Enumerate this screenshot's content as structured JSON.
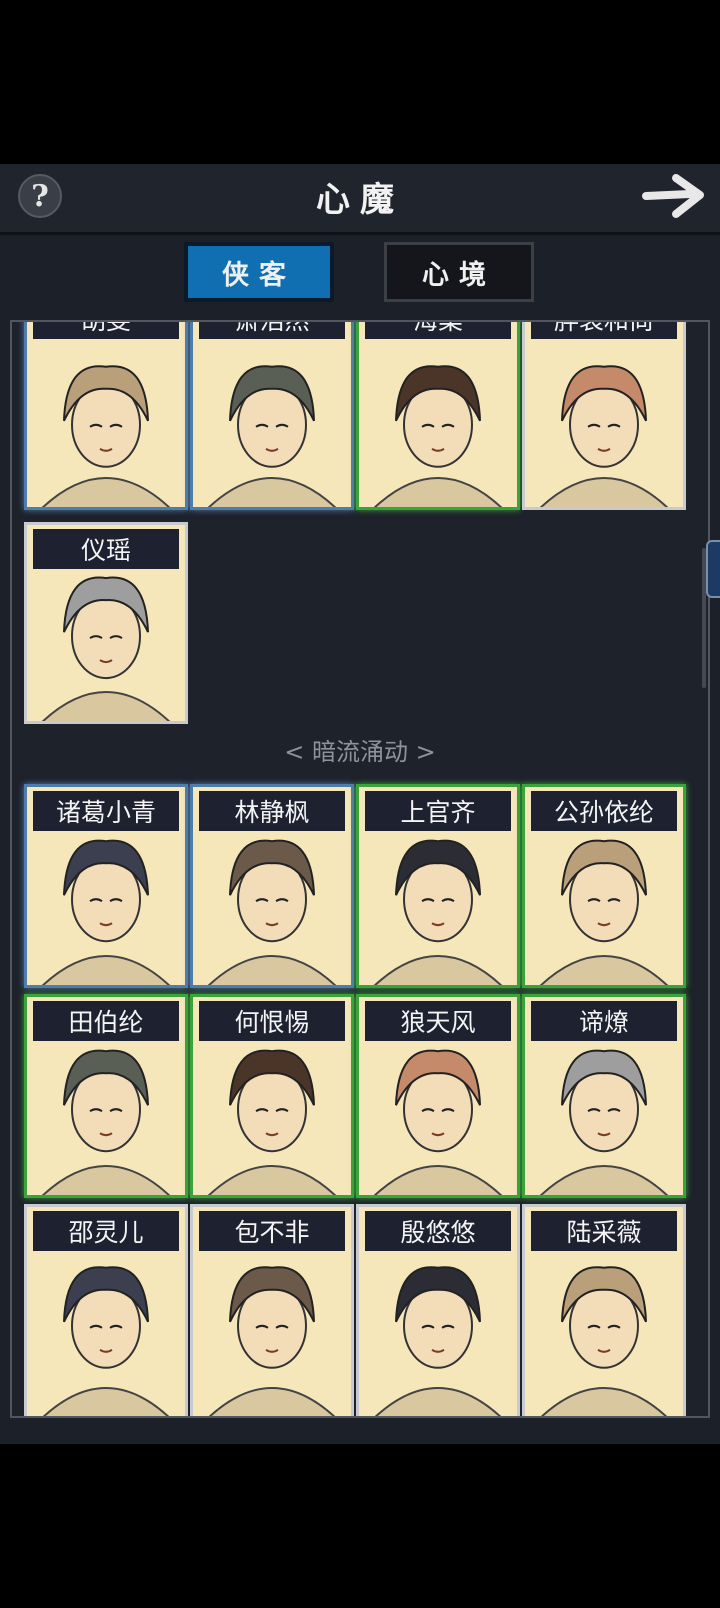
{
  "header": {
    "title": "心魔",
    "help_symbol": "?"
  },
  "tabs": [
    {
      "label": "侠客",
      "active": true
    },
    {
      "label": "心境",
      "active": false
    }
  ],
  "top_cards": [
    {
      "name": "胡斐",
      "rarity": "blue"
    },
    {
      "name": "萧浩然",
      "rarity": "blue"
    },
    {
      "name": "海棠",
      "rarity": "green"
    },
    {
      "name": "胖袋和尚",
      "rarity": "white"
    },
    {
      "name": "仪瑶",
      "rarity": "white"
    }
  ],
  "section_divider": "< 暗流涌动 >",
  "section_cards": [
    {
      "name": "诸葛小青",
      "rarity": "blue"
    },
    {
      "name": "林静枫",
      "rarity": "blue"
    },
    {
      "name": "上官齐",
      "rarity": "green"
    },
    {
      "name": "公孙依纶",
      "rarity": "green"
    },
    {
      "name": "田伯纶",
      "rarity": "green"
    },
    {
      "name": "何恨惕",
      "rarity": "green"
    },
    {
      "name": "狼天风",
      "rarity": "green"
    },
    {
      "name": "谛燎",
      "rarity": "green"
    },
    {
      "name": "邵灵儿",
      "rarity": "white"
    },
    {
      "name": "包不非",
      "rarity": "white"
    },
    {
      "name": "殷悠悠",
      "rarity": "white"
    },
    {
      "name": "陆采薇",
      "rarity": "white"
    }
  ],
  "colors": {
    "blue_frame": "#4f7dab",
    "green_frame": "#3aa33a",
    "white_frame": "#c7cbd0",
    "active_tab": "#0f6fb0",
    "card_bg": "#f6e7bb"
  }
}
